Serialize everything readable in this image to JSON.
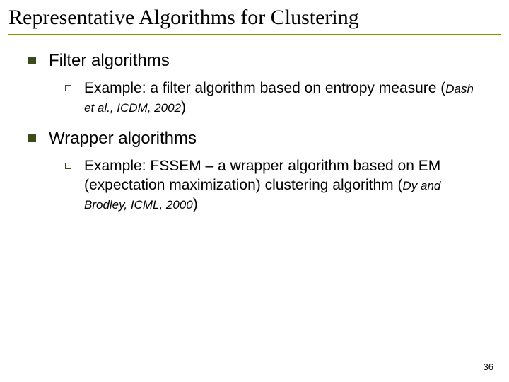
{
  "title": "Representative Algorithms for Clustering",
  "bullets": [
    {
      "label": "Filter algorithms",
      "sub": {
        "prefix": "Example: a filter algorithm based on entropy measure (",
        "cite": "Dash et al., ICDM, 2002",
        "suffix": ")"
      }
    },
    {
      "label": "Wrapper algorithms",
      "sub": {
        "prefix": "Example: FSSEM – a wrapper algorithm based on EM (expectation maximization) clustering algorithm (",
        "cite": "Dy and Brodley, ICML, 2000",
        "suffix": ")"
      }
    }
  ],
  "page_number": "36"
}
